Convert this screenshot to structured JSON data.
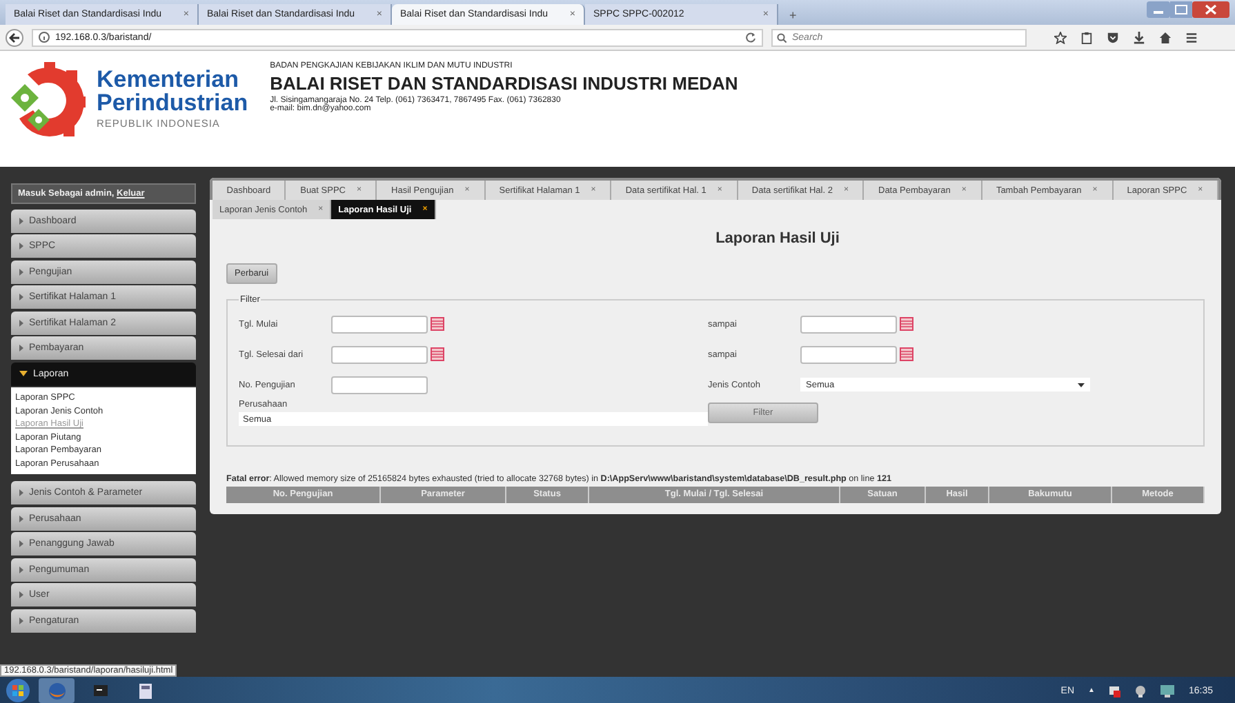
{
  "browser": {
    "tabs": [
      {
        "title": "Balai Riset dan Standardisasi Indu",
        "close": "×",
        "selected": false
      },
      {
        "title": "Balai Riset dan Standardisasi Indu",
        "close": "×",
        "selected": false
      },
      {
        "title": "Balai Riset dan Standardisasi Indu",
        "close": "×",
        "selected": true
      },
      {
        "title": "SPPC SPPC-002012",
        "close": "×",
        "selected": false
      }
    ],
    "new_tab": "+",
    "address": "192.168.0.3/baristand/",
    "search": {
      "placeholder": "Search"
    }
  },
  "site_header": {
    "ministry": "Kementerian",
    "ministry_2": "Perindustrian",
    "country": "REPUBLIK INDONESIA",
    "agency": "BADAN PENGKAJIAN KEBIJAKAN IKLIM DAN MUTU INDUSTRI",
    "title": "BALAI RISET DAN STANDARDISASI INDUSTRI MEDAN",
    "address": "Jl. Sisingamangaraja No. 24 Telp. (061) 7363471, 7867495 Fax. (061) 7362830",
    "email": "e-mail: bim.dn@yahoo.com"
  },
  "sidebar": {
    "login_text": "Masuk Sebagai admin,",
    "logout_link": "Keluar",
    "items": [
      {
        "label": "Dashboard",
        "expanded": false
      },
      {
        "label": "SPPC",
        "expanded": false
      },
      {
        "label": "Pengujian",
        "expanded": false
      },
      {
        "label": "Sertifikat Halaman 1",
        "expanded": false
      },
      {
        "label": "Sertifikat Halaman 2",
        "expanded": false
      },
      {
        "label": "Pembayaran",
        "expanded": false
      },
      {
        "label": "Laporan",
        "expanded": true,
        "children": [
          {
            "label": "Laporan SPPC",
            "selected": false
          },
          {
            "label": "Laporan Jenis Contoh",
            "selected": false
          },
          {
            "label": "Laporan Hasil Uji",
            "selected": true
          },
          {
            "label": "Laporan Piutang",
            "selected": false
          },
          {
            "label": "Laporan Pembayaran",
            "selected": false
          },
          {
            "label": "Laporan Perusahaan",
            "selected": false
          }
        ]
      },
      {
        "label": "Jenis Contoh & Parameter",
        "expanded": false
      },
      {
        "label": "Perusahaan",
        "expanded": false
      },
      {
        "label": "Penanggung Jawab",
        "expanded": false
      },
      {
        "label": "Pengumuman",
        "expanded": false
      },
      {
        "label": "User",
        "expanded": false
      },
      {
        "label": "Pengaturan",
        "expanded": false
      }
    ]
  },
  "page_tabs": [
    [
      {
        "label": "Dashboard",
        "selected": false
      },
      {
        "label": "Buat SPPC",
        "close": "×",
        "selected": false
      },
      {
        "label": "Hasil Pengujian",
        "close": "×",
        "selected": false
      },
      {
        "label": "Sertifikat Halaman 1",
        "close": "×",
        "selected": false
      },
      {
        "label": "Data sertifikat Hal. 1",
        "close": "×",
        "selected": false
      },
      {
        "label": "Data sertifikat Hal. 2",
        "close": "×",
        "selected": false
      },
      {
        "label": "Data Pembayaran",
        "close": "×",
        "selected": false
      },
      {
        "label": "Tambah Pembayaran",
        "close": "×",
        "selected": false
      },
      {
        "label": "Laporan SPPC",
        "close": "×",
        "selected": false
      }
    ],
    [
      {
        "label": "Laporan Jenis Contoh",
        "close": "×",
        "selected": false
      },
      {
        "label": "Laporan Hasil Uji",
        "close": "×",
        "selected": true
      }
    ]
  ],
  "page_title": "Laporan Hasil Uji",
  "refresh_button": "Perbarui",
  "filter": {
    "legend": "Filter",
    "rows": [
      [
        {
          "kind": "date",
          "label": "Tgl. Mulai"
        },
        {
          "kind": "date",
          "label": "sampai"
        }
      ],
      [
        {
          "kind": "date",
          "label": "Tgl. Selesai dari"
        },
        {
          "kind": "date",
          "label": "sampai"
        }
      ],
      [
        {
          "kind": "text",
          "label": "No. Pengujian"
        },
        {
          "kind": "select",
          "label": "Jenis Contoh",
          "value": "Semua"
        }
      ],
      [
        {
          "kind": "wide",
          "label": "Perusahaan",
          "value": "Semua"
        },
        {
          "kind": "button",
          "label": "Filter"
        }
      ]
    ]
  },
  "error": "**Fatal error**: Allowed memory size of 25165824 bytes exhausted (tried to allocate 32768 bytes) in **D:\\AppServ\\www\\baristand\\system\\database\\DB_result.php** on line **121**",
  "table": {
    "columns": [
      "No. Pengujian",
      "Parameter",
      "Status",
      "Tgl. Mulai / Tgl. Selesai",
      "Satuan",
      "Hasil",
      "Bakumutu",
      "Metode"
    ]
  },
  "status_link": "192.168.0.3/baristand/laporan/hasiluji.html",
  "taskbar": {
    "language": "EN",
    "tray_arrow": "▲",
    "time": "16:35"
  }
}
